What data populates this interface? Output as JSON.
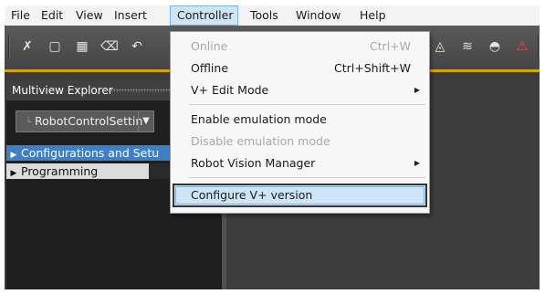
{
  "menubar": {
    "items": [
      "File",
      "Edit",
      "View",
      "Insert",
      "Controller",
      "Tools",
      "Window",
      "Help"
    ]
  },
  "toolbar": {
    "icons": [
      "cut-icon",
      "copy-icon",
      "paste-icon",
      "delete-icon",
      "undo-icon",
      "network-icon",
      "compare-icon",
      "binoculars-icon",
      "alert-icon"
    ],
    "accent_color": "#d9a300"
  },
  "controller_menu": {
    "items": [
      {
        "label": "Online",
        "shortcut": "Ctrl+W",
        "enabled": false
      },
      {
        "label": "Offline",
        "shortcut": "Ctrl+Shift+W",
        "enabled": true
      },
      {
        "label": "V+ Edit Mode",
        "submenu": true,
        "enabled": true
      },
      {
        "label": "Enable emulation mode",
        "enabled": true
      },
      {
        "label": "Disable emulation mode",
        "enabled": false
      },
      {
        "label": "Robot Vision Manager",
        "submenu": true,
        "enabled": true
      },
      {
        "label": "Configure V+ version",
        "enabled": true,
        "highlighted": true
      }
    ]
  },
  "explorer": {
    "title": "Multiview Explorer",
    "device": "RobotControlSettin",
    "tree": [
      {
        "label": "Configurations and Setu",
        "selected": true
      },
      {
        "label": "Programming",
        "selected": false
      }
    ]
  },
  "colors": {
    "selection_blue": "#3f7fc6",
    "menu_hover": "#cde5f7"
  }
}
